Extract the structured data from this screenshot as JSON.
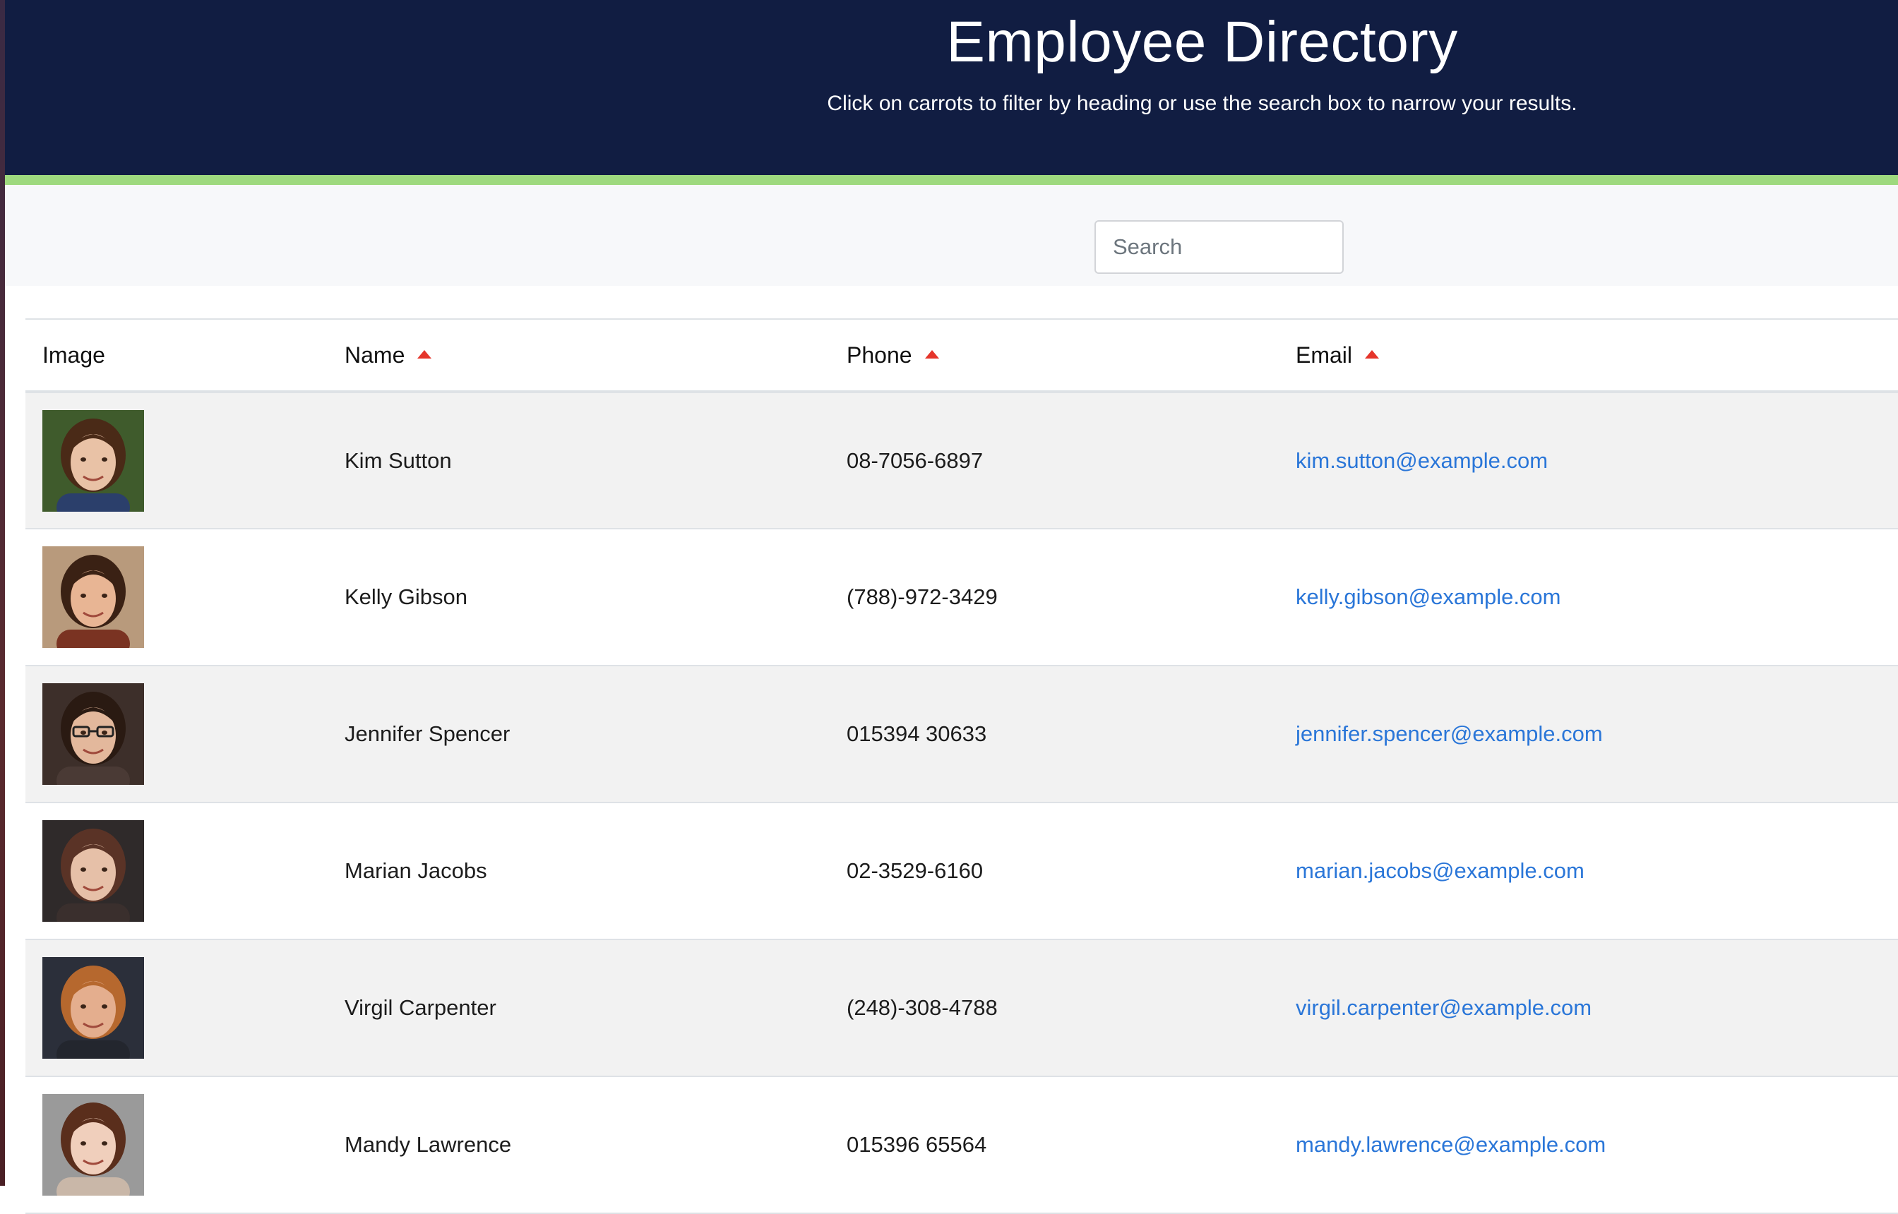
{
  "header": {
    "title": "Employee Directory",
    "subtitle": "Click on carrots to filter by heading or use the search box to narrow your results."
  },
  "search": {
    "placeholder": "Search",
    "value": ""
  },
  "table": {
    "columns": {
      "image": "Image",
      "name": "Name",
      "phone": "Phone",
      "email": "Email"
    },
    "sort_icon": "caret-up-icon",
    "rows": [
      {
        "name": "Kim Sutton",
        "phone": "08-7056-6897",
        "email": "kim.sutton@example.com",
        "avatar": "woman-smiling-photo"
      },
      {
        "name": "Kelly Gibson",
        "phone": "(788)-972-3429",
        "email": "kelly.gibson@example.com",
        "avatar": "woman-smiling-photo"
      },
      {
        "name": "Jennifer Spencer",
        "phone": "015394 30633",
        "email": "jennifer.spencer@example.com",
        "avatar": "woman-glasses-photo"
      },
      {
        "name": "Marian Jacobs",
        "phone": "02-3529-6160",
        "email": "marian.jacobs@example.com",
        "avatar": "woman-photo"
      },
      {
        "name": "Virgil Carpenter",
        "phone": "(248)-308-4788",
        "email": "virgil.carpenter@example.com",
        "avatar": "man-photo"
      },
      {
        "name": "Mandy Lawrence",
        "phone": "015396 65564",
        "email": "mandy.lawrence@example.com",
        "avatar": "woman-photo"
      }
    ]
  },
  "colors": {
    "header_bg": "#111d42",
    "accent_bar": "#9ed97e",
    "sort_caret": "#e5352b",
    "link": "#2a76d8",
    "row_stripe": "#f2f2f2"
  }
}
